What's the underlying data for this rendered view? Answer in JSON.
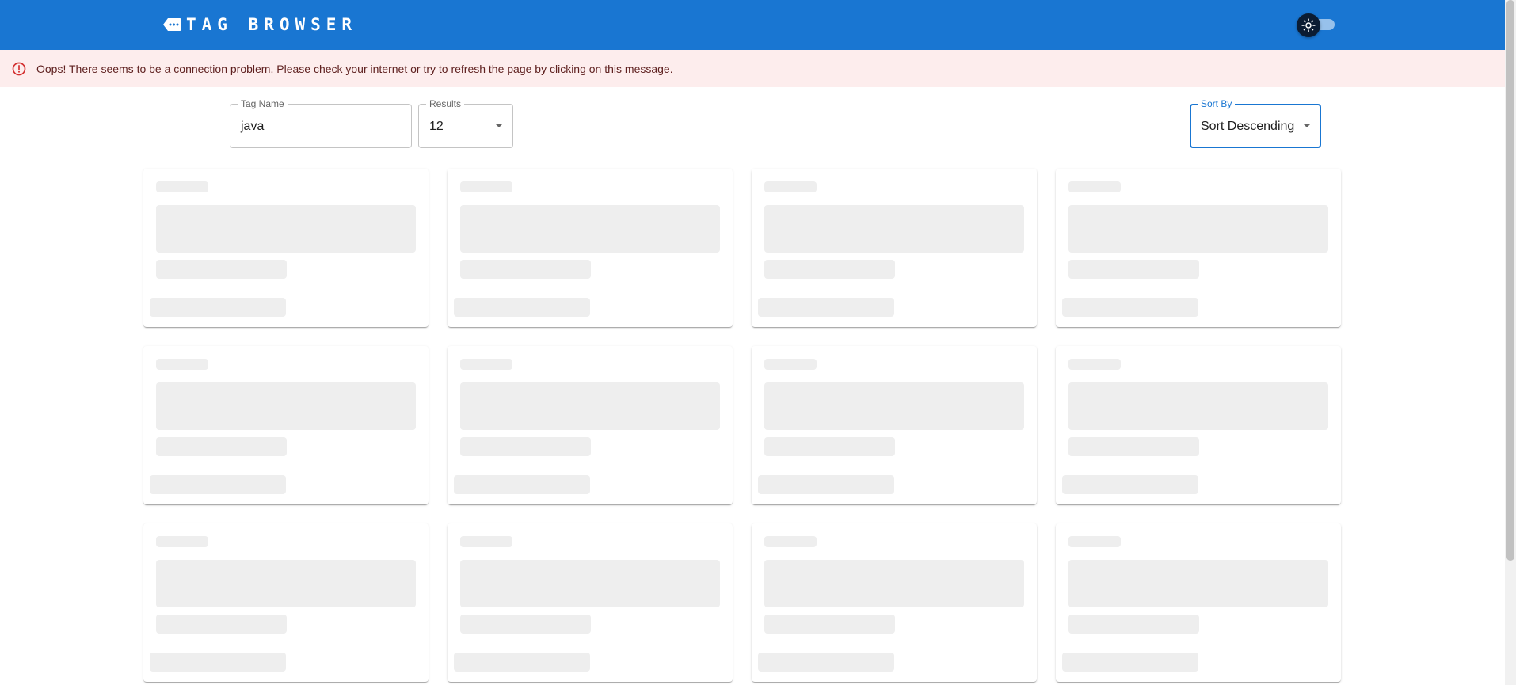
{
  "appbar": {
    "title": "TAG BROWSER",
    "logo_icon": "tag-icon",
    "theme_toggle_icon": "sun-icon"
  },
  "alert": {
    "icon": "error-outline-icon",
    "message": "Oops! There seems to be a connection problem. Please check your internet or try to refresh the page by clicking on this message."
  },
  "filters": {
    "tag_name": {
      "label": "Tag Name",
      "value": "java"
    },
    "results": {
      "label": "Results",
      "value": "12"
    },
    "sort_by": {
      "label": "Sort By",
      "value": "Sort Descending"
    }
  },
  "results_grid": {
    "loading_card_count": 12
  },
  "colors": {
    "primary": "#1976d2",
    "alert_background": "#fdeded",
    "alert_text": "#5f2120",
    "skeleton": "#eeeeee"
  }
}
